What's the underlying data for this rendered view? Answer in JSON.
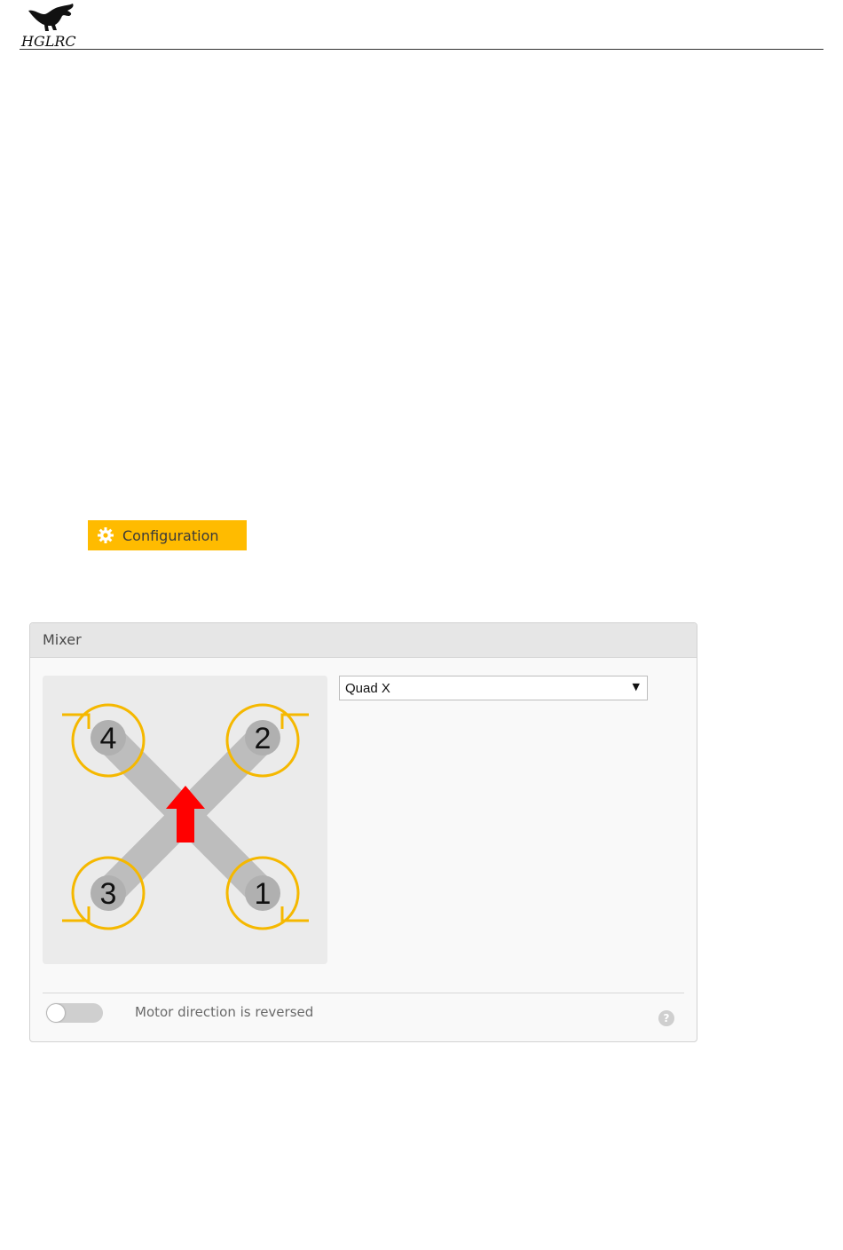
{
  "header": {
    "logo_text": "HGLRC"
  },
  "config_button": {
    "label": "Configuration",
    "icon": "gear-icon",
    "color": "#ffbb00"
  },
  "mixer": {
    "title": "Mixer",
    "selected": "Quad X",
    "diagram": {
      "motors": [
        "4",
        "2",
        "3",
        "1"
      ],
      "prop_color": "#f5b800",
      "arm_color": "#bdbdbd",
      "arrow_color": "#ff0000"
    },
    "reverse_label": "Motor direction is reversed",
    "reversed": false,
    "help": "?"
  }
}
